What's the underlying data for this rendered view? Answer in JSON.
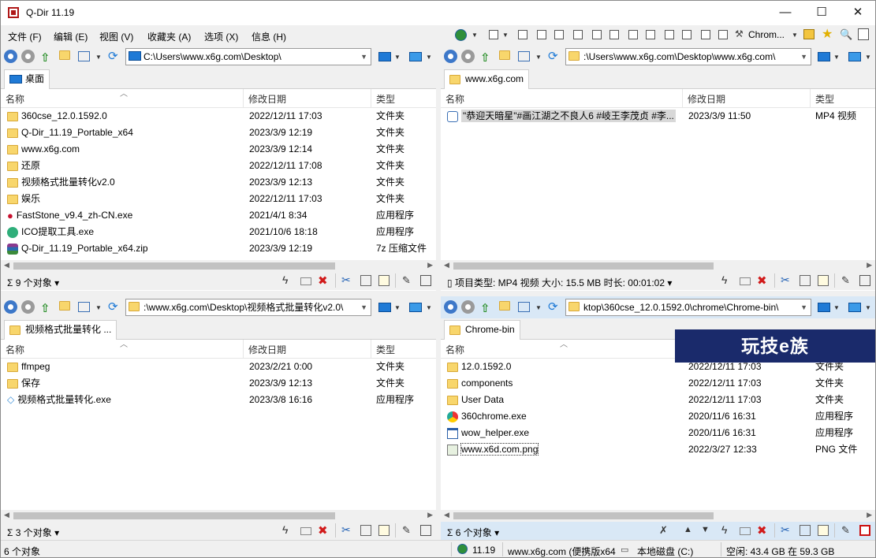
{
  "window": {
    "title": "Q-Dir 11.19",
    "minimize_glyph": "—",
    "maximize_glyph": "☐",
    "close_glyph": "✕"
  },
  "menu": {
    "items": [
      "文件 (F)",
      "编辑 (E)",
      "视图 (V)",
      "收藏夹 (A)",
      "选项 (X)",
      "信息 (H)"
    ],
    "browser_label": "Chrom..."
  },
  "columns": {
    "name": "名称",
    "date": "修改日期",
    "type": "类型"
  },
  "panes": {
    "tl": {
      "address": "C:\\Users\\www.x6g.com\\Desktop\\",
      "tab": "桌面",
      "rows": [
        {
          "name": "360cse_12.0.1592.0",
          "date": "2022/12/11 17:03",
          "type": "文件夹",
          "icon": "folder-icon"
        },
        {
          "name": "Q-Dir_11.19_Portable_x64",
          "date": "2023/3/9 12:19",
          "type": "文件夹",
          "icon": "folder-icon"
        },
        {
          "name": "www.x6g.com",
          "date": "2023/3/9 12:14",
          "type": "文件夹",
          "icon": "folder-icon"
        },
        {
          "name": "还原",
          "date": "2022/12/11 17:08",
          "type": "文件夹",
          "icon": "folder-icon"
        },
        {
          "name": "视频格式批量转化v2.0",
          "date": "2023/3/9 12:13",
          "type": "文件夹",
          "icon": "folder-icon"
        },
        {
          "name": "娱乐",
          "date": "2022/12/11 17:03",
          "type": "文件夹",
          "icon": "folder-icon"
        },
        {
          "name": "FastStone_v9.4_zh-CN.exe",
          "date": "2021/4/1 8:34",
          "type": "应用程序",
          "icon": "cherry-icon"
        },
        {
          "name": "ICO提取工具.exe",
          "date": "2021/10/6 18:18",
          "type": "应用程序",
          "icon": "ico-tool-icon"
        },
        {
          "name": "Q-Dir_11.19_Portable_x64.zip",
          "date": "2023/3/9 12:19",
          "type": "7z 压缩文件",
          "icon": "archive-icon"
        }
      ],
      "status": "9 个对象"
    },
    "tr": {
      "address": ":\\Users\\www.x6g.com\\Desktop\\www.x6g.com\\",
      "tab": "www.x6g.com",
      "rows": [
        {
          "name": "\"恭迎天暗星\"#画江湖之不良人6 #岐王李茂贞 #李...",
          "date": "2023/3/9 11:50",
          "type": "MP4 视频",
          "icon": "video-file-icon",
          "selected": true
        }
      ],
      "status": "项目类型: MP4 视频 大小: 15.5 MB 时长: 00:01:02"
    },
    "bl": {
      "address": ":\\www.x6g.com\\Desktop\\视频格式批量转化v2.0\\",
      "tab": "视频格式批量转化 ...",
      "rows": [
        {
          "name": "ffmpeg",
          "date": "2023/2/21 0:00",
          "type": "文件夹",
          "icon": "folder-icon"
        },
        {
          "name": "保存",
          "date": "2023/3/9 12:13",
          "type": "文件夹",
          "icon": "folder-icon"
        },
        {
          "name": "视频格式批量转化.exe",
          "date": "2023/3/8 16:16",
          "type": "应用程序",
          "icon": "converter-icon"
        }
      ],
      "status": "3 个对象"
    },
    "br": {
      "address": "ktop\\360cse_12.0.1592.0\\chrome\\Chrome-bin\\",
      "tab": "Chrome-bin",
      "banner": "玩技e族",
      "rows": [
        {
          "name": "12.0.1592.0",
          "date": "2022/12/11 17:03",
          "type": "文件夹",
          "icon": "folder-icon"
        },
        {
          "name": "components",
          "date": "2022/12/11 17:03",
          "type": "文件夹",
          "icon": "folder-icon"
        },
        {
          "name": "User Data",
          "date": "2022/12/11 17:03",
          "type": "文件夹",
          "icon": "folder-icon"
        },
        {
          "name": "360chrome.exe",
          "date": "2020/11/6 16:31",
          "type": "应用程序",
          "icon": "chrome-360-icon"
        },
        {
          "name": "wow_helper.exe",
          "date": "2020/11/6 16:31",
          "type": "应用程序",
          "icon": "window-app-icon"
        },
        {
          "name": "www.x6d.com.png",
          "date": "2022/3/27 12:33",
          "type": "PNG 文件",
          "icon": "image-file-icon",
          "focus": true
        }
      ],
      "status": "6 个对象"
    }
  },
  "bottom": {
    "objects": "6 个对象",
    "version": "11.19",
    "site": "www.x6g.com (便携版x64",
    "disk": "本地磁盘 (C:)",
    "space": "空闲: 43.4 GB 在 59.3 GB"
  },
  "colors": {
    "accent": "#1f7ad6",
    "active_bar": "#d9e8f6",
    "folder": "#f8d66c",
    "delete": "#d11a1a"
  }
}
